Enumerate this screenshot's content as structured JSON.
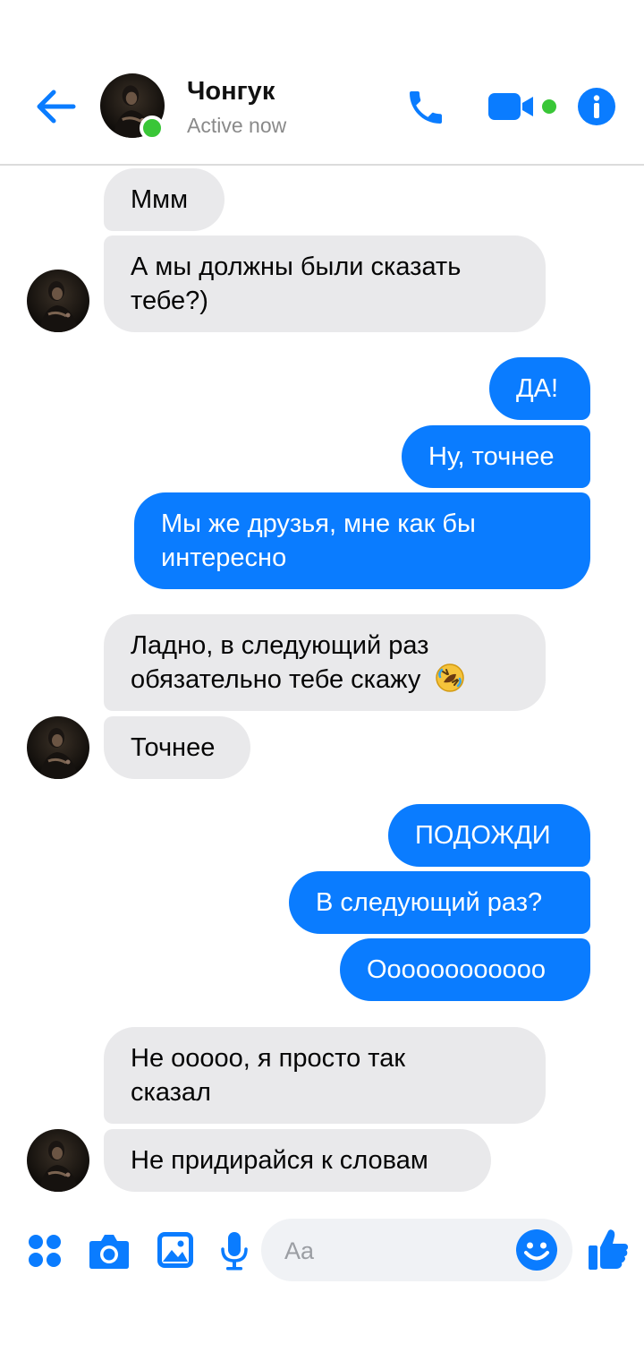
{
  "header": {
    "contact_name": "Чонгук",
    "status": "Active now"
  },
  "composer": {
    "placeholder": "Aa"
  },
  "messages": [
    {
      "side": "incoming",
      "lines": [
        "Ммм"
      ]
    },
    {
      "side": "incoming",
      "lines": [
        "А мы должны были сказать",
        "тебе?)"
      ]
    },
    {
      "side": "outgoing",
      "lines": [
        "ДА!"
      ]
    },
    {
      "side": "outgoing",
      "lines": [
        "Ну, точнее"
      ]
    },
    {
      "side": "outgoing",
      "lines": [
        "Мы же друзья, мне как бы",
        "интересно"
      ]
    },
    {
      "side": "incoming",
      "lines": [
        "Ладно, в следующий раз",
        "обязательно тебе скажу"
      ],
      "emoji": "rolling-on-floor-laughing"
    },
    {
      "side": "incoming",
      "lines": [
        "Точнее"
      ]
    },
    {
      "side": "outgoing",
      "lines": [
        "ПОДОЖДИ"
      ]
    },
    {
      "side": "outgoing",
      "lines": [
        "В следующий раз?"
      ]
    },
    {
      "side": "outgoing",
      "lines": [
        "Оооооооооооо"
      ]
    },
    {
      "side": "incoming",
      "lines": [
        "Не ооооо, я просто так",
        "сказал"
      ]
    },
    {
      "side": "incoming",
      "lines": [
        "Не придирайся к словам"
      ]
    }
  ],
  "colors": {
    "accent": "#0a7cff",
    "incoming_bubble": "#e9e9eb",
    "online": "#39c637"
  },
  "icons": [
    "back-arrow-icon",
    "phone-icon",
    "video-camera-icon",
    "info-icon",
    "apps-grid-icon",
    "camera-icon",
    "gallery-icon",
    "microphone-icon",
    "emoji-icon",
    "thumbs-up-icon"
  ]
}
